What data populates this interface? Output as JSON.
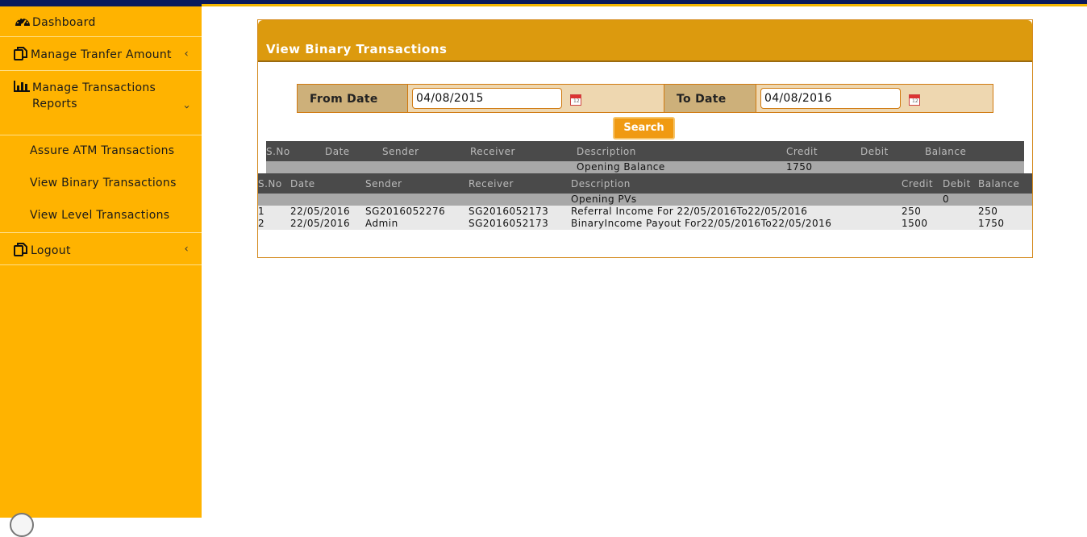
{
  "sidebar": {
    "dashboard": "Dashboard",
    "transfer": "Manage Tranfer Amount",
    "reports": "Manage Transactions Reports",
    "sub_items": [
      "Assure ATM Transactions",
      "View Binary Transactions",
      "View Level Transactions"
    ],
    "logout": "Logout"
  },
  "panel": {
    "title": "View Binary Transactions",
    "from_label": "From Date",
    "from_value": "04/08/2015",
    "to_label": "To Date",
    "to_value": "04/08/2016",
    "search_label": "Search"
  },
  "table1": {
    "headers": [
      "S.No",
      "Date",
      "Sender",
      "Receiver",
      "Description",
      "Credit",
      "Debit",
      "Balance"
    ],
    "opening_label": "Opening Balance",
    "opening_credit": "1750"
  },
  "table2": {
    "headers": [
      "S.No",
      "Date",
      "Sender",
      "Receiver",
      "Description",
      "Credit",
      "Debit",
      "Balance"
    ],
    "opening_label": "Opening PVs",
    "opening_debit": "0",
    "rows": [
      {
        "sno": "1",
        "date": "22/05/2016",
        "sender": "SG2016052276",
        "receiver": "SG2016052173",
        "description": "Referral Income For 22/05/2016To22/05/2016",
        "credit": "250",
        "debit": "",
        "balance": "250"
      },
      {
        "sno": "2",
        "date": "22/05/2016",
        "sender": "Admin",
        "receiver": "SG2016052173",
        "description": "BinaryIncome Payout For22/05/2016To22/05/2016",
        "credit": "1500",
        "debit": "",
        "balance": "1750"
      }
    ]
  },
  "icons": {
    "dashboard": "speedometer-icon",
    "transfer": "copy-icon",
    "reports": "bar-chart-icon",
    "logout": "copy-icon",
    "calendar": "calendar-icon",
    "chevron": "chevron-left-icon"
  },
  "colors": {
    "sidebar": "#ffb300",
    "panel_header": "#dc9a0e",
    "search_button": "#f09a12"
  }
}
